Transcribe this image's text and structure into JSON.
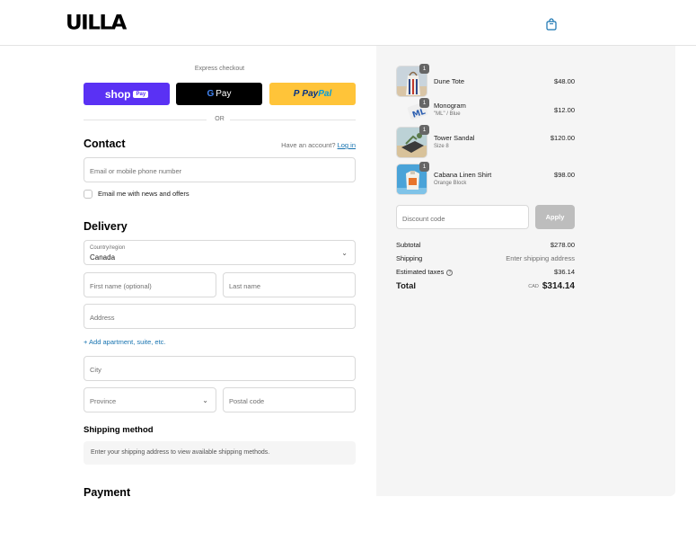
{
  "brand": {
    "logo_text": "UILLA"
  },
  "header": {
    "cart_icon": "shopping-bag-icon"
  },
  "express": {
    "title": "Express checkout",
    "shop_label": "shop",
    "shop_badge": "Pay",
    "gpay_g": "G",
    "gpay_label": "Pay",
    "paypal_p": "P",
    "paypal_pay": "Pay",
    "paypal_pal": "Pal",
    "divider_text": "OR"
  },
  "contact": {
    "title": "Contact",
    "account_prompt": "Have an account?",
    "login_link": "Log in",
    "email_placeholder": "Email or mobile phone number",
    "newsletter_label": "Email me with news and offers"
  },
  "delivery": {
    "title": "Delivery",
    "country_label": "Country/region",
    "country_value": "Canada",
    "first_name_placeholder": "First name (optional)",
    "last_name_placeholder": "Last name",
    "address_placeholder": "Address",
    "add_apartment": "+ Add apartment, suite, etc.",
    "city_placeholder": "City",
    "province_placeholder": "Province",
    "postal_placeholder": "Postal code"
  },
  "shipping_method": {
    "title": "Shipping method",
    "message": "Enter your shipping address to view available shipping methods."
  },
  "payment": {
    "title": "Payment"
  },
  "cart": {
    "items": [
      {
        "name": "Dune Tote",
        "variant": "",
        "price": "$48.00",
        "qty": "1"
      },
      {
        "name": "Monogram",
        "variant": "\"ML\" / Blue",
        "price": "$12.00",
        "qty": "1"
      },
      {
        "name": "Tower Sandal",
        "variant": "Size 8",
        "price": "$120.00",
        "qty": "1"
      },
      {
        "name": "Cabana Linen Shirt",
        "variant": "Orange Block",
        "price": "$98.00",
        "qty": "1"
      }
    ],
    "discount_placeholder": "Discount code",
    "apply_label": "Apply",
    "subtotal_label": "Subtotal",
    "subtotal_value": "$278.00",
    "shipping_label": "Shipping",
    "shipping_value": "Enter shipping address",
    "taxes_label": "Estimated taxes",
    "taxes_info_icon": "?",
    "taxes_value": "$36.14",
    "total_label": "Total",
    "currency": "CAD",
    "total_value": "$314.14"
  },
  "colors": {
    "shop_pay": "#5a31f4",
    "gpay": "#000000",
    "paypal": "#ffc439",
    "link": "#1773b0",
    "summary_bg": "#f5f5f5"
  }
}
